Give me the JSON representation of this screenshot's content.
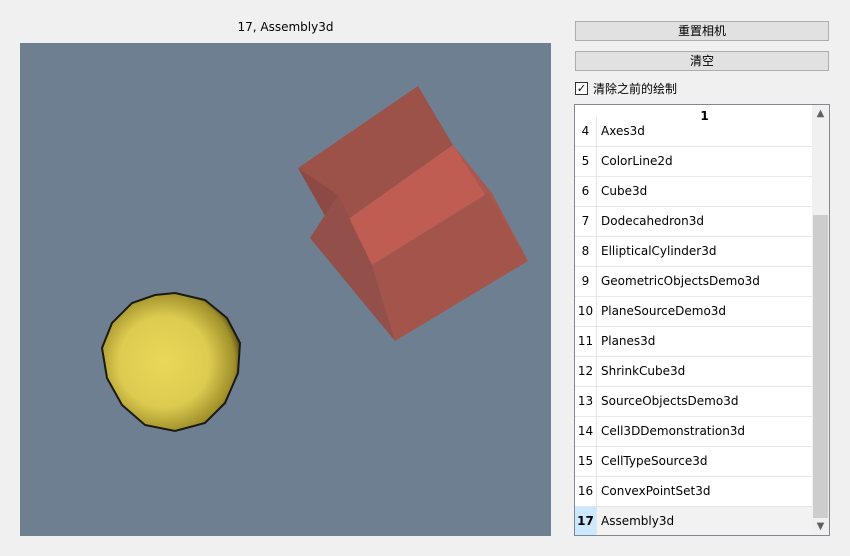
{
  "viewport": {
    "title": "17, Assembly3d"
  },
  "controls": {
    "reset_camera": "重置相机",
    "clear": "清空",
    "clear_previous_label": "清除之前的绘制",
    "clear_previous_checked": true
  },
  "table": {
    "header": "1",
    "rows": [
      {
        "num": "4",
        "name": "Axes3d"
      },
      {
        "num": "5",
        "name": "ColorLine2d"
      },
      {
        "num": "6",
        "name": "Cube3d"
      },
      {
        "num": "7",
        "name": "Dodecahedron3d"
      },
      {
        "num": "8",
        "name": "EllipticalCylinder3d"
      },
      {
        "num": "9",
        "name": "GeometricObjectsDemo3d"
      },
      {
        "num": "10",
        "name": "PlaneSourceDemo3d"
      },
      {
        "num": "11",
        "name": "Planes3d"
      },
      {
        "num": "12",
        "name": "ShrinkCube3d"
      },
      {
        "num": "13",
        "name": "SourceObjectsDemo3d"
      },
      {
        "num": "14",
        "name": "Cell3DDemonstration3d"
      },
      {
        "num": "15",
        "name": "CellTypeSource3d"
      },
      {
        "num": "16",
        "name": "ConvexPointSet3d"
      },
      {
        "num": "17",
        "name": "Assembly3d",
        "selected": true
      }
    ]
  }
}
